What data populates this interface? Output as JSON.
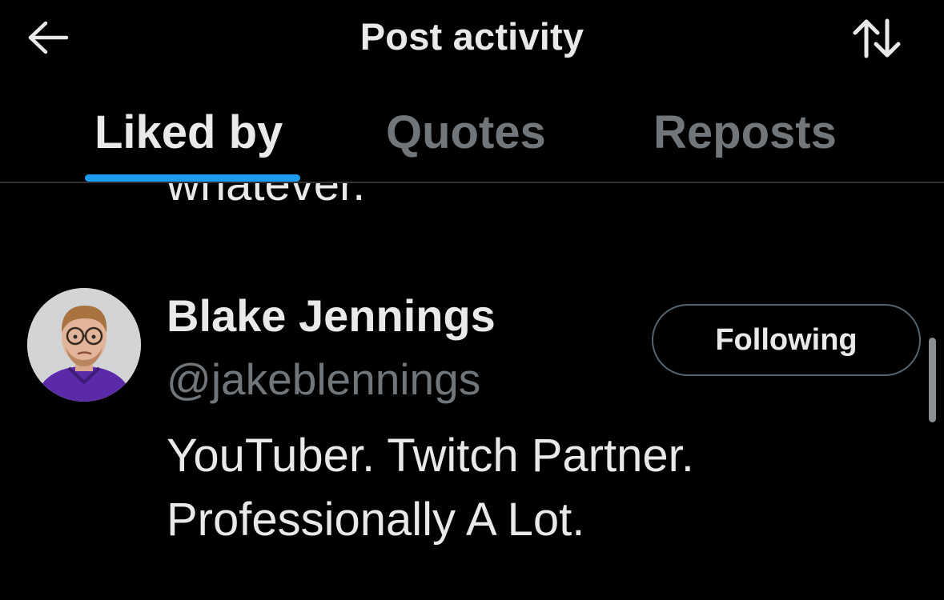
{
  "header": {
    "title": "Post activity",
    "back_icon": "arrow-left-icon",
    "sort_icon": "sort-arrows-icon"
  },
  "tabs": [
    {
      "label": "Liked by",
      "active": true
    },
    {
      "label": "Quotes",
      "active": false
    },
    {
      "label": "Reposts",
      "active": false
    }
  ],
  "list": {
    "cutoff_text": "whatever.",
    "users": [
      {
        "display_name": "Blake Jennings",
        "handle": "@jakeblennings",
        "bio_lines": [
          "YouTuber. Twitch Partner.",
          "Professionally A Lot."
        ],
        "follow_label": "Following"
      }
    ]
  },
  "colors": {
    "background": "#000000",
    "primary_text": "#e7e9ea",
    "secondary_text": "#71767b",
    "accent": "#1d9bf0",
    "divider": "#2f3336"
  }
}
